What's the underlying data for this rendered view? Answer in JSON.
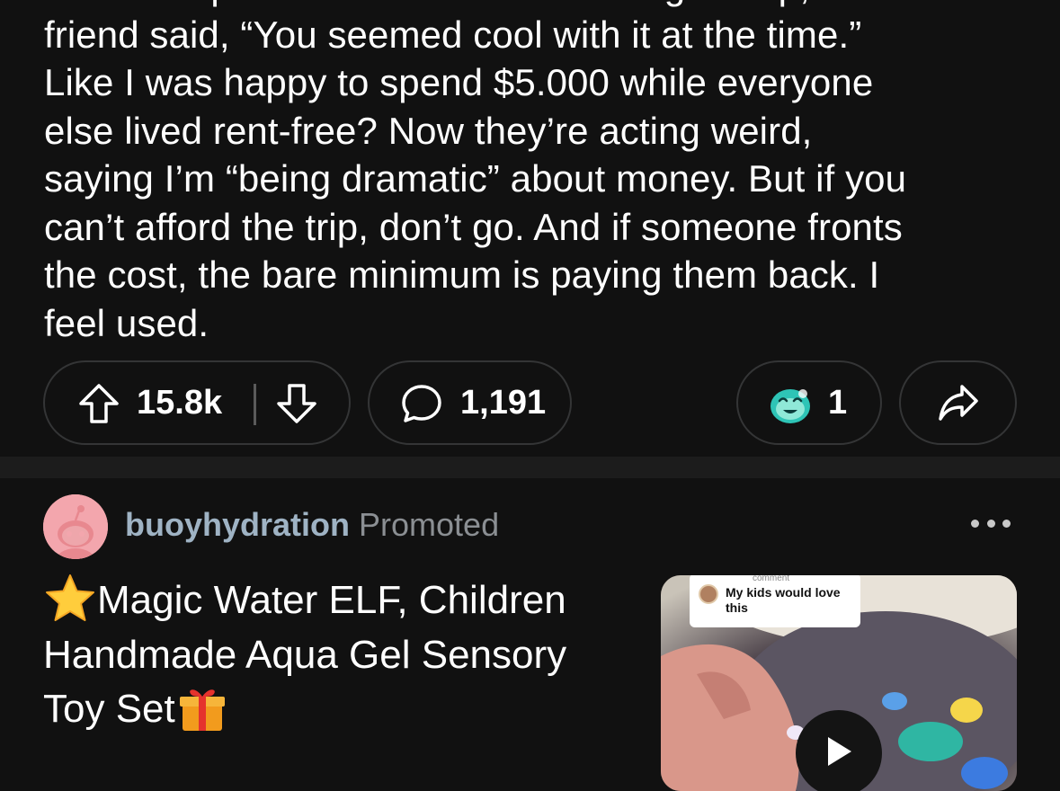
{
  "post": {
    "body": "them has paid me back. When I brought it up, one\nfriend said, “You seemed cool with it at the time.”\nLike I was happy to spend $5.000 while everyone\nelse lived rent-free? Now they’re acting weird,\nsaying I’m “being dramatic” about money. But if you\ncan’t afford the trip, don’t go. And if someone fronts\nthe cost, the bare minimum is paying them back. I\nfeel used.",
    "score": "15.8k",
    "comment_count": "1,191",
    "award_count": "1"
  },
  "ad": {
    "author": "buoyhydration",
    "promoted_label": "Promoted",
    "title": "Magic Water ELF, Children Handmade Aqua Gel Sensory Toy Set",
    "thumbnail": {
      "comment_label": "comment",
      "comment_text": "My kids would love this"
    }
  },
  "icons": {
    "upvote": "upvote-arrow-icon",
    "downvote": "downvote-arrow-icon",
    "comment": "speech-bubble-icon",
    "award": "award-icon",
    "share": "share-arrow-icon",
    "more": "more-horizontal-icon",
    "title_prefix": "star-emoji",
    "title_suffix": "gift-emoji",
    "play": "play-icon"
  },
  "colors": {
    "background": "#111111",
    "separator": "#1c1c1c",
    "pill_border": "#343536",
    "author": "#9fb3c4",
    "muted": "#8b8f93"
  }
}
